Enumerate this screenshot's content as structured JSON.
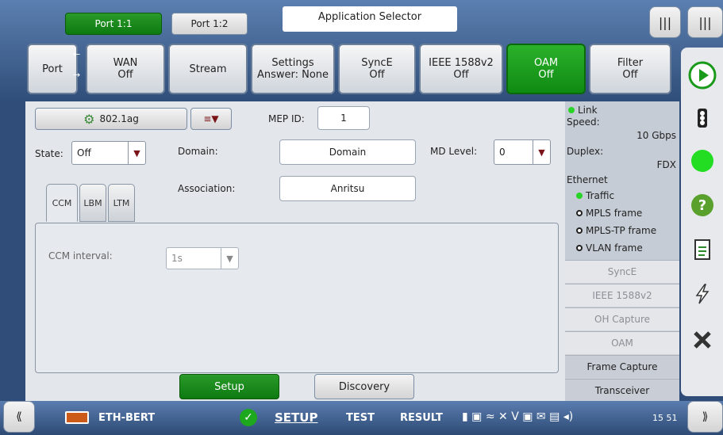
{
  "ports": {
    "port1": "Port 1:1",
    "port2": "Port 1:2"
  },
  "app_selector": "Application Selector",
  "tabs": [
    {
      "line1": "Port",
      "line2": ""
    },
    {
      "line1": "WAN",
      "line2": "Off"
    },
    {
      "line1": "Stream",
      "line2": ""
    },
    {
      "line1": "Settings",
      "line2": "Answer: None"
    },
    {
      "line1": "SyncE",
      "line2": "Off"
    },
    {
      "line1": "IEEE 1588v2",
      "line2": "Off"
    },
    {
      "line1": "OAM",
      "line2": "Off"
    },
    {
      "line1": "Filter",
      "line2": "Off"
    }
  ],
  "main": {
    "profile": "802.1ag",
    "mep_label": "MEP ID:",
    "mep_value": "1",
    "state_label": "State:",
    "state_value": "Off",
    "domain_label": "Domain:",
    "domain_value": "Domain",
    "md_label": "MD Level:",
    "md_value": "0",
    "assoc_label": "Association:",
    "assoc_value": "Anritsu",
    "subtabs": [
      "CCM",
      "LBM",
      "LTM"
    ],
    "ccm_label": "CCM interval:",
    "ccm_value": "1s",
    "setup_button": "Setup",
    "discovery_button": "Discovery"
  },
  "status": {
    "link": "Link",
    "speed_label": "Speed:",
    "speed_value": "10 Gbps",
    "duplex_label": "Duplex:",
    "duplex_value": "FDX",
    "ethernet": "Ethernet",
    "traffic": "Traffic",
    "mpls": "MPLS frame",
    "mplstp": "MPLS-TP frame",
    "vlan": "VLAN frame",
    "items": [
      "SyncE",
      "IEEE 1588v2",
      "OH Capture",
      "OAM",
      "Frame Capture",
      "Transceiver"
    ]
  },
  "bottom": {
    "app": "ETH-BERT",
    "setup": "SETUP",
    "test": "TEST",
    "result": "RESULT",
    "time": "15 51"
  },
  "colors": {
    "accent_green": "#1a9a1a",
    "header_blue": "#2f4d78"
  }
}
